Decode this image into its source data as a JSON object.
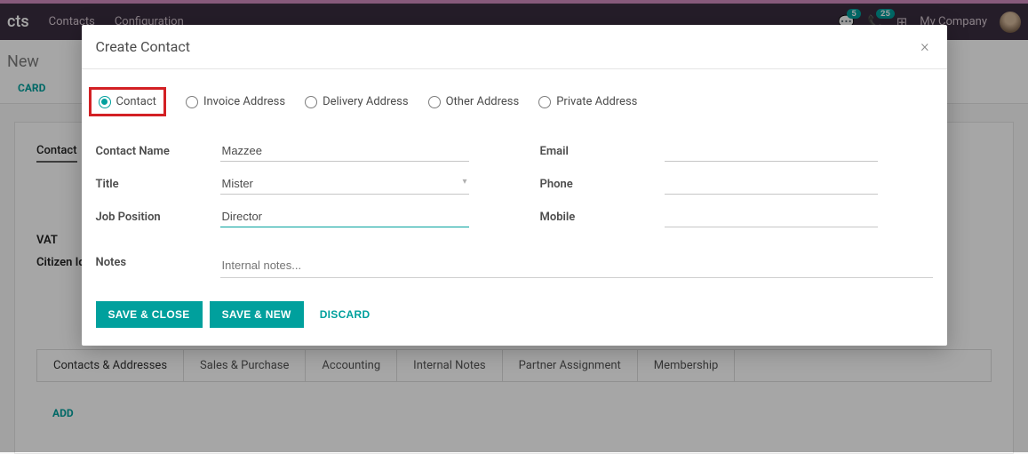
{
  "header": {
    "app_tail": "cts",
    "menu": [
      "Contacts",
      "Configuration"
    ],
    "chat_count": "5",
    "call_count": "25",
    "company": "My Company"
  },
  "breadcrumb": "New",
  "card_label": "CARD",
  "bg": {
    "tab_active": "Contact",
    "fields": [
      "VAT",
      "Citizen Ide"
    ],
    "tabs": [
      "Contacts & Addresses",
      "Sales & Purchase",
      "Accounting",
      "Internal Notes",
      "Partner Assignment",
      "Membership"
    ],
    "add": "ADD"
  },
  "modal": {
    "title": "Create Contact",
    "types": [
      "Contact",
      "Invoice Address",
      "Delivery Address",
      "Other Address",
      "Private Address"
    ],
    "selected_type_index": 0,
    "labels": {
      "contact_name": "Contact Name",
      "title": "Title",
      "job_position": "Job Position",
      "email": "Email",
      "phone": "Phone",
      "mobile": "Mobile",
      "notes": "Notes"
    },
    "values": {
      "contact_name": "Mazzee",
      "title": "Mister",
      "job_position": "Director",
      "email": "",
      "phone": "",
      "mobile": ""
    },
    "notes_placeholder": "Internal notes...",
    "buttons": {
      "save_close": "SAVE & CLOSE",
      "save_new": "SAVE & NEW",
      "discard": "DISCARD"
    }
  }
}
